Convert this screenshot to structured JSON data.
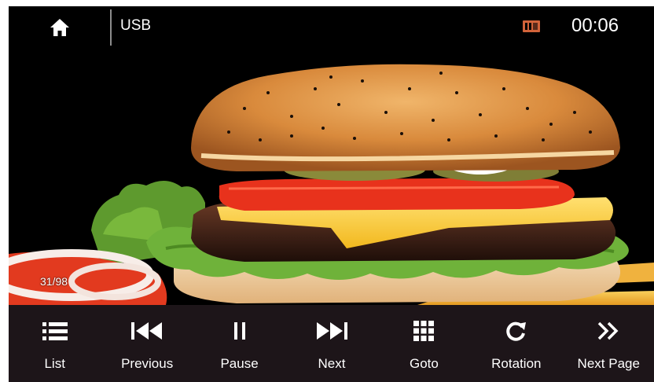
{
  "header": {
    "home_icon": "home-icon",
    "source": "USB",
    "storage_icon": "sd-card-icon",
    "time": "00:06"
  },
  "viewer": {
    "counter": "31/98"
  },
  "controls": [
    {
      "label": "List",
      "icon": "list-icon"
    },
    {
      "label": "Previous",
      "icon": "previous-icon"
    },
    {
      "label": "Pause",
      "icon": "pause-icon"
    },
    {
      "label": "Next",
      "icon": "next-icon"
    },
    {
      "label": "Goto",
      "icon": "grid-icon"
    },
    {
      "label": "Rotation",
      "icon": "rotate-icon"
    },
    {
      "label": "Next Page",
      "icon": "double-chevron-right-icon"
    }
  ],
  "colors": {
    "background": "#000000",
    "control_bar": "#1d1519",
    "text": "#ffffff"
  }
}
